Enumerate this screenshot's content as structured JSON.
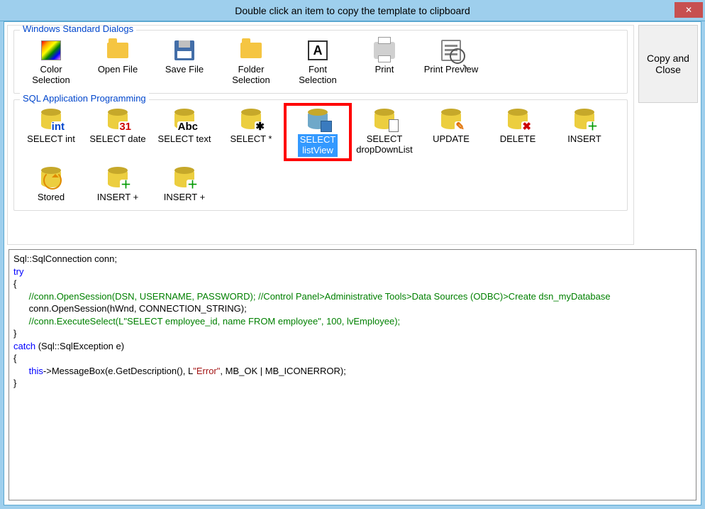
{
  "window": {
    "title": "Double click an item to copy the template to clipboard"
  },
  "buttons": {
    "close": "✕",
    "copy_close": "Copy and Close"
  },
  "groups": [
    {
      "id": "std",
      "title": "Windows Standard Dialogs",
      "items": [
        {
          "id": "color",
          "label": "Color\nSelection",
          "icon": "color"
        },
        {
          "id": "open",
          "label": "Open File",
          "icon": "folder"
        },
        {
          "id": "save",
          "label": "Save File",
          "icon": "disk"
        },
        {
          "id": "folder",
          "label": "Folder\nSelection",
          "icon": "folder"
        },
        {
          "id": "font",
          "label": "Font\nSelection",
          "icon": "font"
        },
        {
          "id": "print",
          "label": "Print",
          "icon": "printer"
        },
        {
          "id": "preview",
          "label": "Print Preview",
          "icon": "preview"
        }
      ]
    },
    {
      "id": "sql",
      "title": "SQL Application Programming",
      "items": [
        {
          "id": "sel-int",
          "label": "SELECT int",
          "icon": "db",
          "badge": "int",
          "badge_color": "#0046cc"
        },
        {
          "id": "sel-date",
          "label": "SELECT date",
          "icon": "db",
          "badge": "31",
          "badge_color": "#cc0000"
        },
        {
          "id": "sel-text",
          "label": "SELECT text",
          "icon": "db",
          "badge": "Abc",
          "badge_color": "#000"
        },
        {
          "id": "sel-star",
          "label": "SELECT *",
          "icon": "db",
          "badge": "✱",
          "badge_color": "#000"
        },
        {
          "id": "sel-lv",
          "label": "SELECT\nlistView",
          "icon": "db_blue",
          "selected": true
        },
        {
          "id": "sel-dd",
          "label": "SELECT\ndropDownList",
          "icon": "db_file"
        },
        {
          "id": "update",
          "label": "UPDATE",
          "icon": "db",
          "badge": "✎",
          "badge_color": "#e07000"
        },
        {
          "id": "delete",
          "label": "DELETE",
          "icon": "db",
          "badge": "✖",
          "badge_color": "#cc0000"
        },
        {
          "id": "insert",
          "label": "INSERT",
          "icon": "db",
          "badge": "＋",
          "badge_color": "#009900"
        },
        {
          "id": "stored",
          "label": "Stored",
          "icon": "db_refresh"
        },
        {
          "id": "insertp1",
          "label": "INSERT +",
          "icon": "db",
          "badge": "＋",
          "badge_color": "#009900"
        },
        {
          "id": "insertp2",
          "label": "INSERT +",
          "icon": "db",
          "badge": "＋",
          "badge_color": "#009900"
        }
      ]
    }
  ],
  "code": {
    "line1": "Sql::SqlConnection conn;",
    "line2_kw": "try",
    "line3": "{",
    "line4_com": "      //conn.OpenSession(DSN, USERNAME, PASSWORD); //Control Panel>Administrative Tools>Data Sources (ODBC)>Create dsn_myDatabase",
    "line5": "      conn.OpenSession(hWnd, CONNECTION_STRING);",
    "line6_com": "      //conn.ExecuteSelect(L\"SELECT employee_id, name FROM employee\", 100, lvEmployee);",
    "line7": "}",
    "line8_kw": "catch",
    "line8_rest": " (Sql::SqlException e)",
    "line9": "{",
    "line10_this": "this",
    "line10_a": "->MessageBox(e.GetDescription(), L",
    "line10_str": "\"Error\"",
    "line10_b": ", MB_OK | MB_ICONERROR);",
    "line11": "}"
  }
}
